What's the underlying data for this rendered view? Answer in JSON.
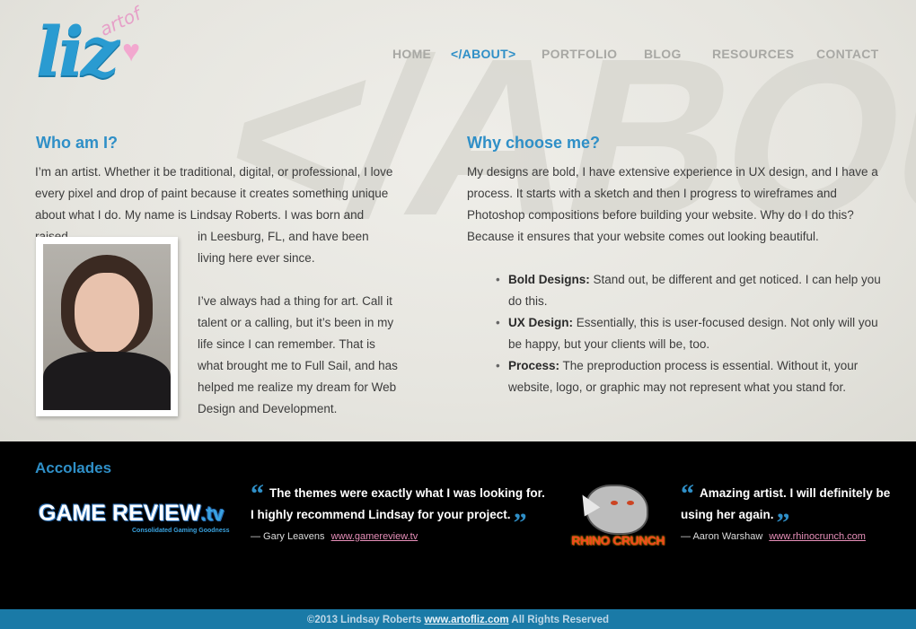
{
  "logo": {
    "art_of": "artof",
    "name": "liz"
  },
  "nav": {
    "items": [
      {
        "label": "HOME"
      },
      {
        "label": "</ABOUT>"
      },
      {
        "label": "PORTFOLIO"
      },
      {
        "label": "BLOG"
      },
      {
        "label": "RESOURCES"
      },
      {
        "label": "CONTACT"
      }
    ],
    "active": "</ABOUT>",
    "accent_color": "#2f8fc7"
  },
  "background_word": "</ABOU",
  "who": {
    "heading": "Who am I?",
    "intro": "I’m an artist. Whether it be traditional, digital, or professional, I love every pixel and drop of paint because it creates something unique about what I do. My name is Lindsay Roberts. I was born and raised",
    "continued": "in Leesburg, FL, and have been living here ever since.",
    "paragraph2": "I’ve always had a thing for art. Call it talent or a calling, but it’s been in my life since I can remember. That is what brought me to Full Sail, and has helped me realize my dream for Web Design and Development."
  },
  "why": {
    "heading": "Why choose me?",
    "intro": "My designs are bold, I have extensive experience in UX design, and I have a process.  It starts with a sketch and then I progress to wireframes and Photoshop compositions before building your website. Why do I do this? Because it ensures that your website comes out looking beautiful.",
    "reasons": [
      {
        "title": "Bold Designs:",
        "text": " Stand out, be different and get noticed. I can help you do this."
      },
      {
        "title": "UX Design:",
        "text": " Essentially, this is user-focused design. Not only will you be happy, but your clients will be, too."
      },
      {
        "title": "Process:",
        "text": " The preproduction process is essential. Without it, your website, logo, or graphic may not represent what you stand for."
      }
    ]
  },
  "accolades": {
    "heading": "Accolades",
    "items": [
      {
        "logo_main": "GAME REVIEW",
        "logo_tv": ".tv",
        "logo_sub": "Consolidated Gaming Goodness",
        "quote": "The themes were exactly what I was looking for. I highly recommend Lindsay for your project.",
        "author": "— Gary Leavens",
        "link": "www.gamereview.tv"
      },
      {
        "logo_text": "RHINO CRUNCH",
        "quote": "Amazing artist. I will definitely be using her again.",
        "author": "— Aaron Warshaw",
        "link": "www.rhinocrunch.com"
      }
    ]
  },
  "footer": {
    "copyright": "©2013 Lindsay Roberts",
    "site": "www.artofliz.com",
    "rights": "All Rights Reserved"
  }
}
